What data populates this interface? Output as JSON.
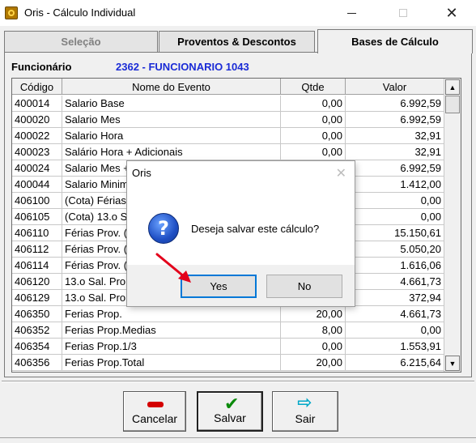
{
  "window": {
    "title": "Oris - Cálculo Individual"
  },
  "tabs": [
    {
      "label": "Seleção"
    },
    {
      "label": "Proventos & Descontos"
    },
    {
      "label": "Bases de Cálculo"
    }
  ],
  "funcionario": {
    "label": "Funcionário",
    "value": "2362 - FUNCIONARIO 1043"
  },
  "grid": {
    "headers": [
      "Código",
      "Nome do Evento",
      "Qtde",
      "Valor"
    ],
    "rows": [
      [
        "400014",
        "Salario Base",
        "0,00",
        "6.992,59"
      ],
      [
        "400020",
        "Salario Mes",
        "0,00",
        "6.992,59"
      ],
      [
        "400022",
        "Salario Hora",
        "0,00",
        "32,91"
      ],
      [
        "400023",
        "Salário Hora + Adicionais",
        "0,00",
        "32,91"
      ],
      [
        "400024",
        "Salario Mes +",
        "",
        "6.992,59"
      ],
      [
        "400044",
        "Salario Minim",
        "",
        "1.412,00"
      ],
      [
        "406100",
        "(Cota) Férias",
        "",
        "0,00"
      ],
      [
        "406105",
        "(Cota) 13.o S",
        "",
        "0,00"
      ],
      [
        "406110",
        "Férias Prov. (",
        "",
        "15.150,61"
      ],
      [
        "406112",
        "Férias Prov. (",
        "",
        "5.050,20"
      ],
      [
        "406114",
        "Férias Prov. (",
        "",
        "1.616,06"
      ],
      [
        "406120",
        "13.o Sal. Pro",
        "",
        "4.661,73"
      ],
      [
        "406129",
        "13.o Sal. Pro",
        "",
        "372,94"
      ],
      [
        "406350",
        "Ferias Prop.",
        "20,00",
        "4.661,73"
      ],
      [
        "406352",
        "Ferias Prop.Medias",
        "8,00",
        "0,00"
      ],
      [
        "406354",
        "Ferias Prop.1/3",
        "0,00",
        "1.553,91"
      ],
      [
        "406356",
        "Ferias Prop.Total",
        "20,00",
        "6.215,64"
      ]
    ]
  },
  "buttons": {
    "cancelar": "Cancelar",
    "salvar": "Salvar",
    "sair": "Sair"
  },
  "dialog": {
    "title": "Oris",
    "message": "Deseja salvar este cálculo?",
    "yes": "Yes",
    "no": "No"
  },
  "colors": {
    "accent_blue": "#1a2bd6",
    "annotation_red": "#e3001b",
    "default_button_border": "#0078d7"
  }
}
